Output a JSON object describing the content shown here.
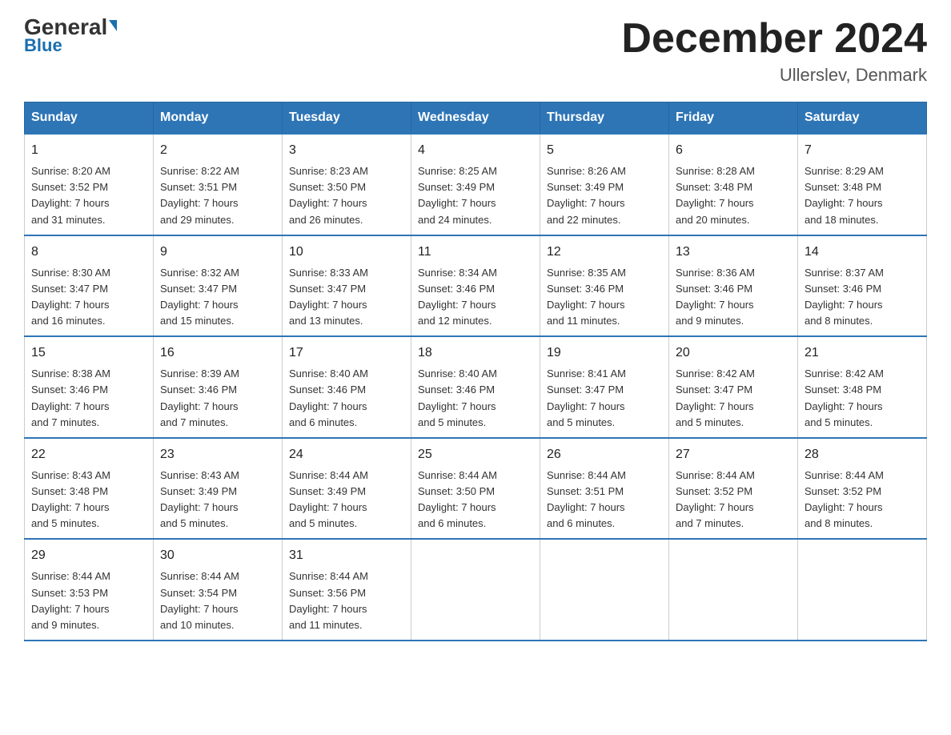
{
  "header": {
    "logo_general": "General",
    "logo_blue": "Blue",
    "month_title": "December 2024",
    "location": "Ullerslev, Denmark"
  },
  "weekdays": [
    "Sunday",
    "Monday",
    "Tuesday",
    "Wednesday",
    "Thursday",
    "Friday",
    "Saturday"
  ],
  "weeks": [
    [
      {
        "day": "1",
        "sunrise": "8:20 AM",
        "sunset": "3:52 PM",
        "daylight": "7 hours and 31 minutes."
      },
      {
        "day": "2",
        "sunrise": "8:22 AM",
        "sunset": "3:51 PM",
        "daylight": "7 hours and 29 minutes."
      },
      {
        "day": "3",
        "sunrise": "8:23 AM",
        "sunset": "3:50 PM",
        "daylight": "7 hours and 26 minutes."
      },
      {
        "day": "4",
        "sunrise": "8:25 AM",
        "sunset": "3:49 PM",
        "daylight": "7 hours and 24 minutes."
      },
      {
        "day": "5",
        "sunrise": "8:26 AM",
        "sunset": "3:49 PM",
        "daylight": "7 hours and 22 minutes."
      },
      {
        "day": "6",
        "sunrise": "8:28 AM",
        "sunset": "3:48 PM",
        "daylight": "7 hours and 20 minutes."
      },
      {
        "day": "7",
        "sunrise": "8:29 AM",
        "sunset": "3:48 PM",
        "daylight": "7 hours and 18 minutes."
      }
    ],
    [
      {
        "day": "8",
        "sunrise": "8:30 AM",
        "sunset": "3:47 PM",
        "daylight": "7 hours and 16 minutes."
      },
      {
        "day": "9",
        "sunrise": "8:32 AM",
        "sunset": "3:47 PM",
        "daylight": "7 hours and 15 minutes."
      },
      {
        "day": "10",
        "sunrise": "8:33 AM",
        "sunset": "3:47 PM",
        "daylight": "7 hours and 13 minutes."
      },
      {
        "day": "11",
        "sunrise": "8:34 AM",
        "sunset": "3:46 PM",
        "daylight": "7 hours and 12 minutes."
      },
      {
        "day": "12",
        "sunrise": "8:35 AM",
        "sunset": "3:46 PM",
        "daylight": "7 hours and 11 minutes."
      },
      {
        "day": "13",
        "sunrise": "8:36 AM",
        "sunset": "3:46 PM",
        "daylight": "7 hours and 9 minutes."
      },
      {
        "day": "14",
        "sunrise": "8:37 AM",
        "sunset": "3:46 PM",
        "daylight": "7 hours and 8 minutes."
      }
    ],
    [
      {
        "day": "15",
        "sunrise": "8:38 AM",
        "sunset": "3:46 PM",
        "daylight": "7 hours and 7 minutes."
      },
      {
        "day": "16",
        "sunrise": "8:39 AM",
        "sunset": "3:46 PM",
        "daylight": "7 hours and 7 minutes."
      },
      {
        "day": "17",
        "sunrise": "8:40 AM",
        "sunset": "3:46 PM",
        "daylight": "7 hours and 6 minutes."
      },
      {
        "day": "18",
        "sunrise": "8:40 AM",
        "sunset": "3:46 PM",
        "daylight": "7 hours and 5 minutes."
      },
      {
        "day": "19",
        "sunrise": "8:41 AM",
        "sunset": "3:47 PM",
        "daylight": "7 hours and 5 minutes."
      },
      {
        "day": "20",
        "sunrise": "8:42 AM",
        "sunset": "3:47 PM",
        "daylight": "7 hours and 5 minutes."
      },
      {
        "day": "21",
        "sunrise": "8:42 AM",
        "sunset": "3:48 PM",
        "daylight": "7 hours and 5 minutes."
      }
    ],
    [
      {
        "day": "22",
        "sunrise": "8:43 AM",
        "sunset": "3:48 PM",
        "daylight": "7 hours and 5 minutes."
      },
      {
        "day": "23",
        "sunrise": "8:43 AM",
        "sunset": "3:49 PM",
        "daylight": "7 hours and 5 minutes."
      },
      {
        "day": "24",
        "sunrise": "8:44 AM",
        "sunset": "3:49 PM",
        "daylight": "7 hours and 5 minutes."
      },
      {
        "day": "25",
        "sunrise": "8:44 AM",
        "sunset": "3:50 PM",
        "daylight": "7 hours and 6 minutes."
      },
      {
        "day": "26",
        "sunrise": "8:44 AM",
        "sunset": "3:51 PM",
        "daylight": "7 hours and 6 minutes."
      },
      {
        "day": "27",
        "sunrise": "8:44 AM",
        "sunset": "3:52 PM",
        "daylight": "7 hours and 7 minutes."
      },
      {
        "day": "28",
        "sunrise": "8:44 AM",
        "sunset": "3:52 PM",
        "daylight": "7 hours and 8 minutes."
      }
    ],
    [
      {
        "day": "29",
        "sunrise": "8:44 AM",
        "sunset": "3:53 PM",
        "daylight": "7 hours and 9 minutes."
      },
      {
        "day": "30",
        "sunrise": "8:44 AM",
        "sunset": "3:54 PM",
        "daylight": "7 hours and 10 minutes."
      },
      {
        "day": "31",
        "sunrise": "8:44 AM",
        "sunset": "3:56 PM",
        "daylight": "7 hours and 11 minutes."
      },
      null,
      null,
      null,
      null
    ]
  ],
  "labels": {
    "sunrise": "Sunrise:",
    "sunset": "Sunset:",
    "daylight": "Daylight:"
  }
}
